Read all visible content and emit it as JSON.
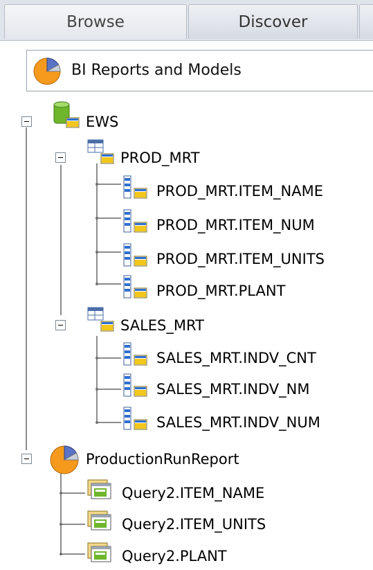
{
  "tabs": [
    {
      "label": "Browse",
      "active": true
    },
    {
      "label": "Discover",
      "active": false
    }
  ],
  "selector": {
    "label": "BI Reports and Models",
    "icon": "pie-chart-icon"
  },
  "tree": [
    {
      "label": "EWS",
      "icon": "database-icon",
      "expanded": true
    },
    {
      "label": "PROD_MRT",
      "icon": "table-icon",
      "expanded": true
    },
    {
      "label": "PROD_MRT.ITEM_NAME",
      "icon": "column-icon"
    },
    {
      "label": "PROD_MRT.ITEM_NUM",
      "icon": "column-icon"
    },
    {
      "label": "PROD_MRT.ITEM_UNITS",
      "icon": "column-icon"
    },
    {
      "label": "PROD_MRT.PLANT",
      "icon": "column-icon"
    },
    {
      "label": "SALES_MRT",
      "icon": "table-icon",
      "expanded": true
    },
    {
      "label": "SALES_MRT.INDV_CNT",
      "icon": "column-icon"
    },
    {
      "label": "SALES_MRT.INDV_NM",
      "icon": "column-icon"
    },
    {
      "label": "SALES_MRT.INDV_NUM",
      "icon": "column-icon"
    },
    {
      "label": "ProductionRunReport",
      "icon": "pie-chart-icon",
      "expanded": true
    },
    {
      "label": "Query2.ITEM_NAME",
      "icon": "query-icon"
    },
    {
      "label": "Query2.ITEM_UNITS",
      "icon": "query-icon"
    },
    {
      "label": "Query2.PLANT",
      "icon": "query-icon"
    }
  ],
  "colors": {
    "pie_orange": "#f59a1c",
    "pie_blue": "#5b73c4",
    "db_green": "#6fb62d",
    "table_yellow": "#f2c61a",
    "column_blue": "#2f6fd0",
    "tree_line": "#8c8c8c"
  }
}
